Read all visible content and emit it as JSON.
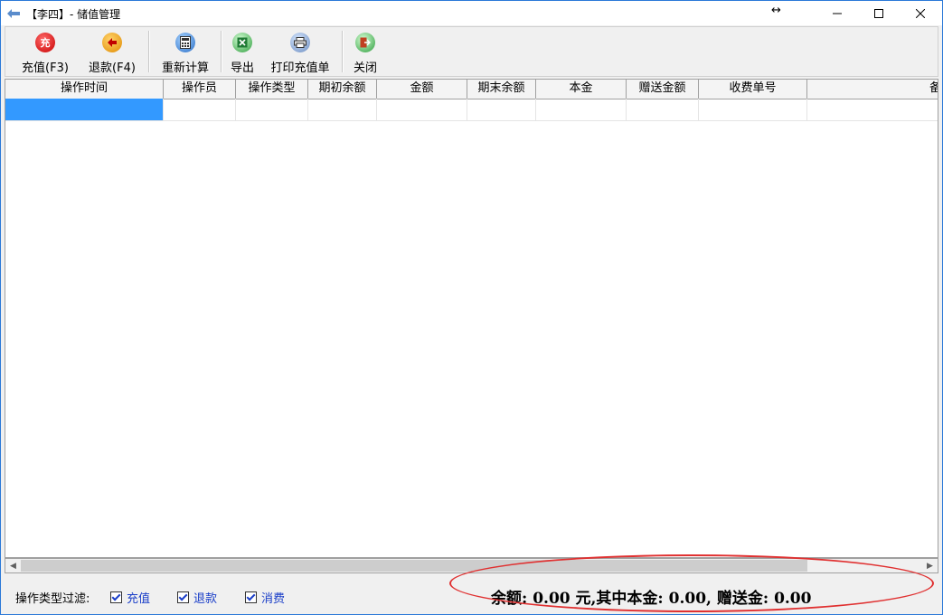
{
  "window": {
    "title": "【李四】- 储值管理",
    "resize_glyph": "↔"
  },
  "toolbar": {
    "recharge_label": "充值(F3)",
    "refund_label": "退款(F4)",
    "recalc_label": "重新计算",
    "export_label": "导出",
    "print_label": "打印充值单",
    "close_label": "关闭",
    "recharge_icon_text": "充"
  },
  "grid": {
    "columns": [
      "操作时间",
      "操作员",
      "操作类型",
      "期初余额",
      "金额",
      "期末余额",
      "本金",
      "赠送金额",
      "收费单号",
      "备"
    ]
  },
  "filter": {
    "label": "操作类型过滤:",
    "options": [
      {
        "label": "充值",
        "checked": true
      },
      {
        "label": "退款",
        "checked": true
      },
      {
        "label": "消费",
        "checked": true
      }
    ]
  },
  "summary": {
    "text": "余额: 0.00 元,其中本金: 0.00, 赠送金: 0.00"
  },
  "colors": {
    "selection": "#3399ff",
    "highlight_ellipse": "#e03030",
    "checkbox_text": "#1a3ec8"
  }
}
